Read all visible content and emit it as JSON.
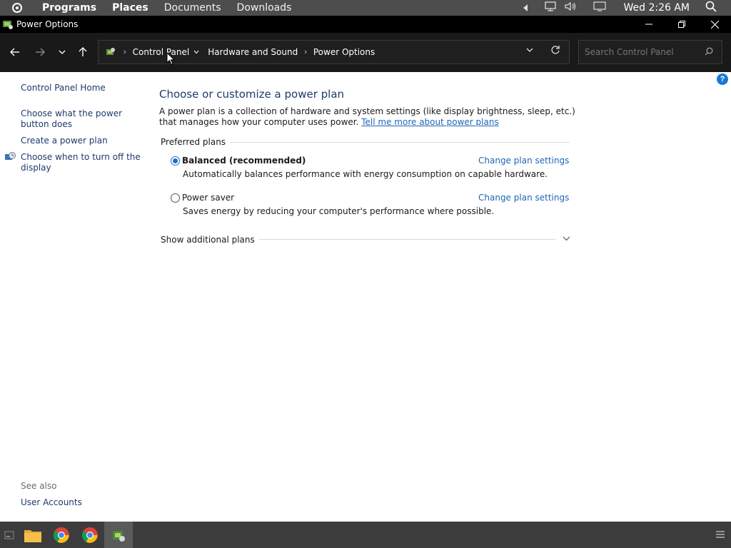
{
  "topbar": {
    "menus": [
      "Programs",
      "Places",
      "Documents",
      "Downloads"
    ],
    "clock": "Wed 2:26 AM"
  },
  "window": {
    "title": "Power Options"
  },
  "address": {
    "crumbs": [
      "Control Panel",
      "Hardware and Sound",
      "Power Options"
    ]
  },
  "search": {
    "placeholder": "Search Control Panel"
  },
  "sidebar": {
    "items": [
      "Control Panel Home",
      "Choose what the power button does",
      "Create a power plan",
      "Choose when to turn off the display"
    ],
    "see_also_label": "See also",
    "see_also_items": [
      "User Accounts"
    ]
  },
  "main": {
    "heading": "Choose or customize a power plan",
    "description": "A power plan is a collection of hardware and system settings (like display brightness, sleep, etc.) that manages how your computer uses power.",
    "learn_more": "Tell me more about power plans",
    "preferred_label": "Preferred plans",
    "plans": [
      {
        "name": "Balanced (recommended)",
        "description": "Automatically balances performance with energy consumption on capable hardware.",
        "link": "Change plan settings",
        "selected": true
      },
      {
        "name": "Power saver",
        "description": "Saves energy by reducing your computer's performance where possible.",
        "link": "Change plan settings",
        "selected": false
      }
    ],
    "additional_label": "Show additional plans"
  },
  "colors": {
    "accent": "#1a6fc4",
    "link": "#1e66b5",
    "heading": "#1e3a6b"
  }
}
